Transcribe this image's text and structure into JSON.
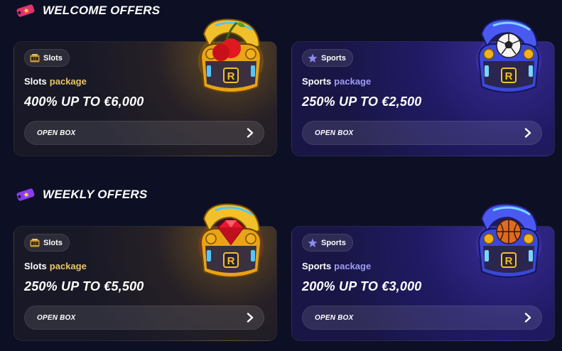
{
  "sections": [
    {
      "title": "WELCOME OFFERS",
      "icon": "ticket-star-icon",
      "cards": [
        {
          "category": "Slots",
          "category_icon": "slot-machine-icon",
          "package_name": "Slots",
          "package_word": "package",
          "offer": "400% UP TO €6,000",
          "button": "OPEN BOX",
          "art": "gold-box-cherry-icon",
          "theme": "slots"
        },
        {
          "category": "Sports",
          "category_icon": "sports-star-icon",
          "package_name": "Sports",
          "package_word": "package",
          "offer": "250% UP TO €2,500",
          "button": "OPEN BOX",
          "art": "blue-box-soccer-ball-icon",
          "theme": "sports"
        }
      ]
    },
    {
      "title": "WEEKLY OFFERS",
      "icon": "ticket-star-icon",
      "cards": [
        {
          "category": "Slots",
          "category_icon": "slot-machine-icon",
          "package_name": "Slots",
          "package_word": "package",
          "offer": "250% UP TO €5,500",
          "button": "OPEN BOX",
          "art": "gold-box-ruby-icon",
          "theme": "slots"
        },
        {
          "category": "Sports",
          "category_icon": "sports-star-icon",
          "package_name": "Sports",
          "package_word": "package",
          "offer": "200% UP TO €3,000",
          "button": "OPEN BOX",
          "art": "blue-box-basketball-icon",
          "theme": "sports"
        }
      ]
    }
  ],
  "colors": {
    "background": "#0d0f24",
    "slots_accent": "#e8c66a",
    "sports_accent": "#9f9cf3",
    "ticket_pink": "#e0336e",
    "ticket_purple": "#8a3cf0"
  }
}
